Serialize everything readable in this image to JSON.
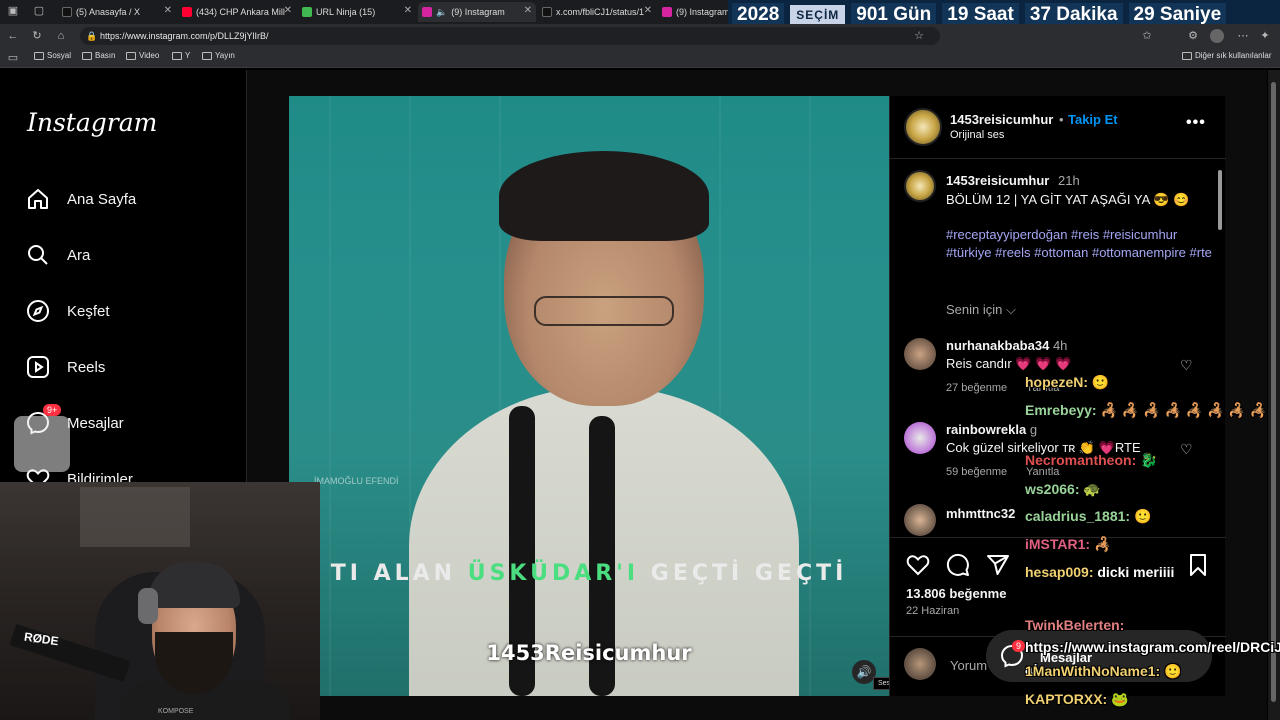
{
  "browser": {
    "tabs": [
      {
        "label": "(5) Anasayfa / X",
        "color": "#222222"
      },
      {
        "label": "(434) CHP Ankara Mill",
        "color": "#ff0033"
      },
      {
        "label": "URL Ninja (15)",
        "color": "#3fb950"
      },
      {
        "label": "(9) Instagram",
        "color": "#d6249f"
      },
      {
        "label": "x.com/fbliCJ1/status/1",
        "color": "#222222"
      },
      {
        "label": "(9) Instagram",
        "color": "#d6249f"
      }
    ],
    "url": "https://www.instagram.com/p/DLLZ9jYlIrB/",
    "bookmarks": [
      "Sosyal",
      "Basın",
      "Video",
      "Y",
      "Yayın"
    ],
    "other_bookmarks": "Diğer sık kullanılanlar"
  },
  "countdown": {
    "year": "2028",
    "label": "SEÇİM",
    "days": "901 Gün",
    "hours": "19 Saat",
    "minutes": "37 Dakika",
    "seconds": "29 Saniye"
  },
  "instagram": {
    "logo": "Instagram",
    "nav": [
      {
        "label": "Ana Sayfa",
        "icon": "home-icon"
      },
      {
        "label": "Ara",
        "icon": "search-icon"
      },
      {
        "label": "Keşfet",
        "icon": "compass-icon"
      },
      {
        "label": "Reels",
        "icon": "reels-icon"
      },
      {
        "label": "Mesajlar",
        "icon": "messenger-icon"
      },
      {
        "label": "Bildirimler",
        "icon": "heart-icon"
      }
    ],
    "messages_badge": "9+",
    "video": {
      "watermark": "İMAMOĞLU EFENDİ",
      "caption_a": "TI ALAN ",
      "caption_hl": "ÜSKÜDAR'I",
      "caption_b": " GEÇTİ GEÇTİ",
      "brand": "1453Reisicumhur",
      "audio_tooltip": "Ses oynatılıyor"
    },
    "post": {
      "username": "1453reisicumhur",
      "follow_sep": "•",
      "follow": "Takip Et",
      "audio": "Orijinal ses",
      "caption_time": "21h",
      "caption_text": "BÖLÜM  12 | YA GİT YAT AŞAĞI YA 😎 😊",
      "hashtags": "#receptayyiperdoğan #reis #reisicumhur #türkiye #reels #ottoman #ottomanempire #rte",
      "for_you": "Senin için ⌵",
      "likes": "13.806 beğenme",
      "date": "22 Haziran",
      "comment_placeholder": "Yorum ekle..."
    },
    "comments": [
      {
        "user": "nurhanakbaba34",
        "time": "4h",
        "text": "Reis candır 💗 💗 💗",
        "likes": "27 beğenme",
        "reply": "Yanıtla"
      },
      {
        "user": "rainbowrekla",
        "time": "g",
        "text": "Cok güzel sirkeliyor ᴛʀ 👏 💗RTE",
        "likes": "59 beğenme",
        "reply": "Yanıtla"
      },
      {
        "user": "mhmttnc32",
        "time": "",
        "text": "",
        "likes": "",
        "reply": ""
      }
    ],
    "messages_pill": {
      "label": "Mesajlar",
      "badge": "9"
    }
  },
  "stream_chat": [
    {
      "user": "hopezeN:",
      "text": "🙂",
      "color": "#f0d070"
    },
    {
      "user": "Emrebeyy:",
      "text": "🦂 🦂 🦂 🦂 🦂 🦂 🦂 🦂",
      "color": "#9ad39a"
    },
    {
      "user": "Necromantheon:",
      "text": "🐉",
      "color": "#e05050"
    },
    {
      "user": "ws2066:",
      "text": "🐢",
      "color": "#9ad39a"
    },
    {
      "user": "caladrius_1881:",
      "text": "🙂",
      "color": "#9ad39a"
    },
    {
      "user": "iMSTAR1:",
      "text": "🦂",
      "color": "#e06080"
    },
    {
      "user": "hesap009:",
      "text": "dicki meriiii",
      "color": "#f0d070"
    },
    {
      "user": "TwinkBelerten:",
      "text": "https://www.instagram.com/reel/DRCiJVDjE-a/",
      "color": "#e08080"
    },
    {
      "user": "1ManWithNoName1:",
      "text": "🙂",
      "color": "#f0d070"
    },
    {
      "user": "KAPTORXX:",
      "text": "🐸",
      "color": "#f0d070"
    }
  ],
  "webcam": {
    "mic_brand": "RØDE",
    "shirt_text": "KOMPOSE"
  },
  "colors": {
    "link_blue": "#0095f6",
    "hashtag": "#a4a7f4",
    "badge_red": "#ff3040",
    "video_teal": "#248c88"
  }
}
